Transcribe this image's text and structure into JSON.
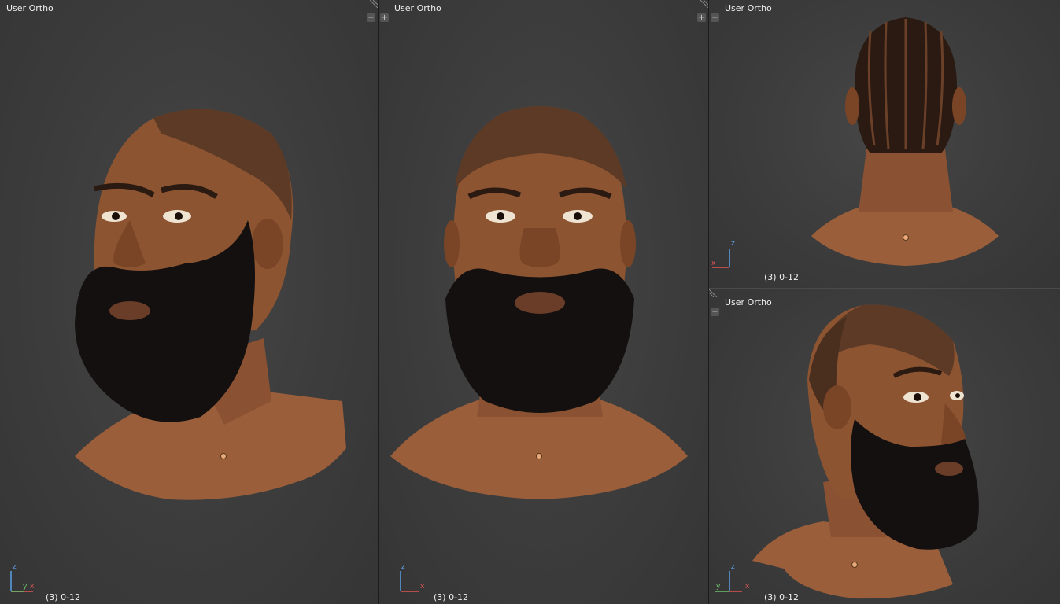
{
  "viewports": [
    {
      "id": "left",
      "label": "User Ortho",
      "frame": "(3) 0-12",
      "axes": [
        "z",
        "y",
        "x"
      ]
    },
    {
      "id": "middle",
      "label": "User Ortho",
      "frame": "(3) 0-12",
      "axes": [
        "z",
        "x"
      ]
    },
    {
      "id": "top-right",
      "label": "User Ortho",
      "frame": "(3) 0-12",
      "axes": [
        "z",
        "x"
      ]
    },
    {
      "id": "bottom-right",
      "label": "User Ortho",
      "frame": "(3) 0-12",
      "axes": [
        "z",
        "y",
        "x"
      ]
    }
  ],
  "icons": {
    "add": "plus-icon",
    "split": "corner-split-icon"
  },
  "colors": {
    "background": "#3c3c3c",
    "skin": "#9a5e3a",
    "beard": "#141010",
    "axis_x": "#e05555",
    "axis_y": "#6fc16f",
    "axis_z": "#5aa0e6",
    "origin": "#e8a877"
  }
}
